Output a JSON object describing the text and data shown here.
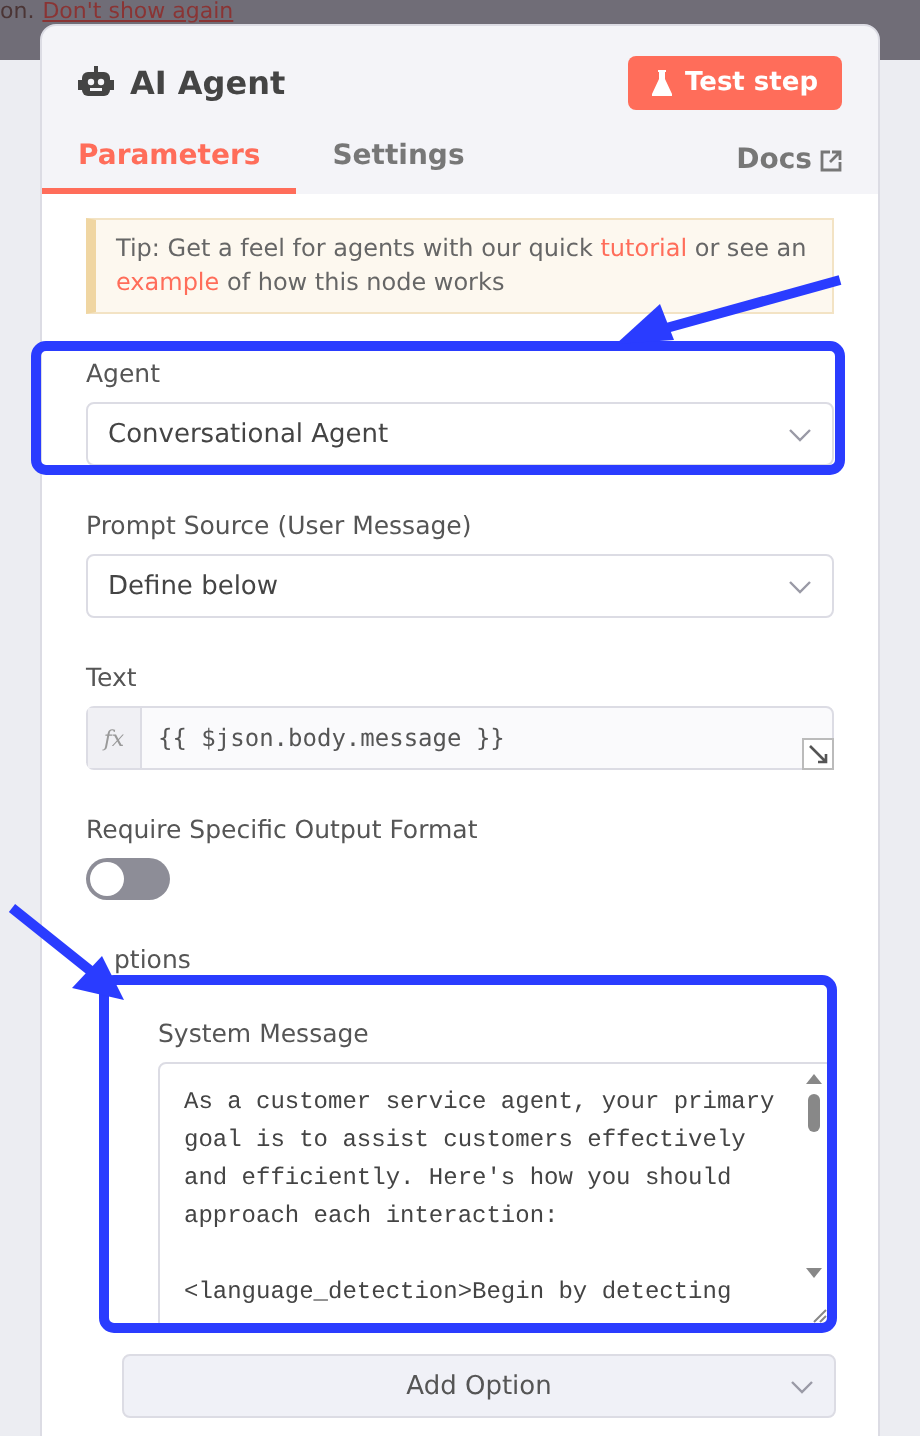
{
  "backdrop": {
    "notice": "on.",
    "notice_link": "Don't show again"
  },
  "header": {
    "title": "AI Agent",
    "test_button": "Test step"
  },
  "tabs": [
    {
      "label": "Parameters",
      "selected": true
    },
    {
      "label": "Settings",
      "selected": false
    }
  ],
  "docs_link": "Docs",
  "tip": [
    {
      "kind": "text",
      "text": "Tip: Get a feel for agents with our quick "
    },
    {
      "kind": "link",
      "text": "tutorial"
    },
    {
      "kind": "text",
      "text": " or see an "
    },
    {
      "kind": "link",
      "text": "example"
    },
    {
      "kind": "text",
      "text": " of how this node works"
    }
  ],
  "fields": [
    {
      "kind": "select",
      "label": "Agent",
      "value": "Conversational Agent",
      "highlighted": true
    },
    {
      "kind": "select",
      "label": "Prompt Source (User Message)",
      "value": "Define below",
      "highlighted": false
    },
    {
      "kind": "expression",
      "label": "Text",
      "prefix": "fx",
      "value": "{{ $json.body.message }}",
      "highlighted": false
    },
    {
      "kind": "toggle",
      "label": "Require Specific Output Format",
      "on": false,
      "highlighted": false
    }
  ],
  "options": {
    "label": "ptions",
    "items": [
      {
        "label": "System Message",
        "value": "As a customer service agent, your primary goal is to assist customers effectively and efficiently. Here's how you should approach each interaction:\n\n<language_detection>Begin by detecting",
        "highlighted": true
      }
    ],
    "add_button": "Add Option"
  }
}
